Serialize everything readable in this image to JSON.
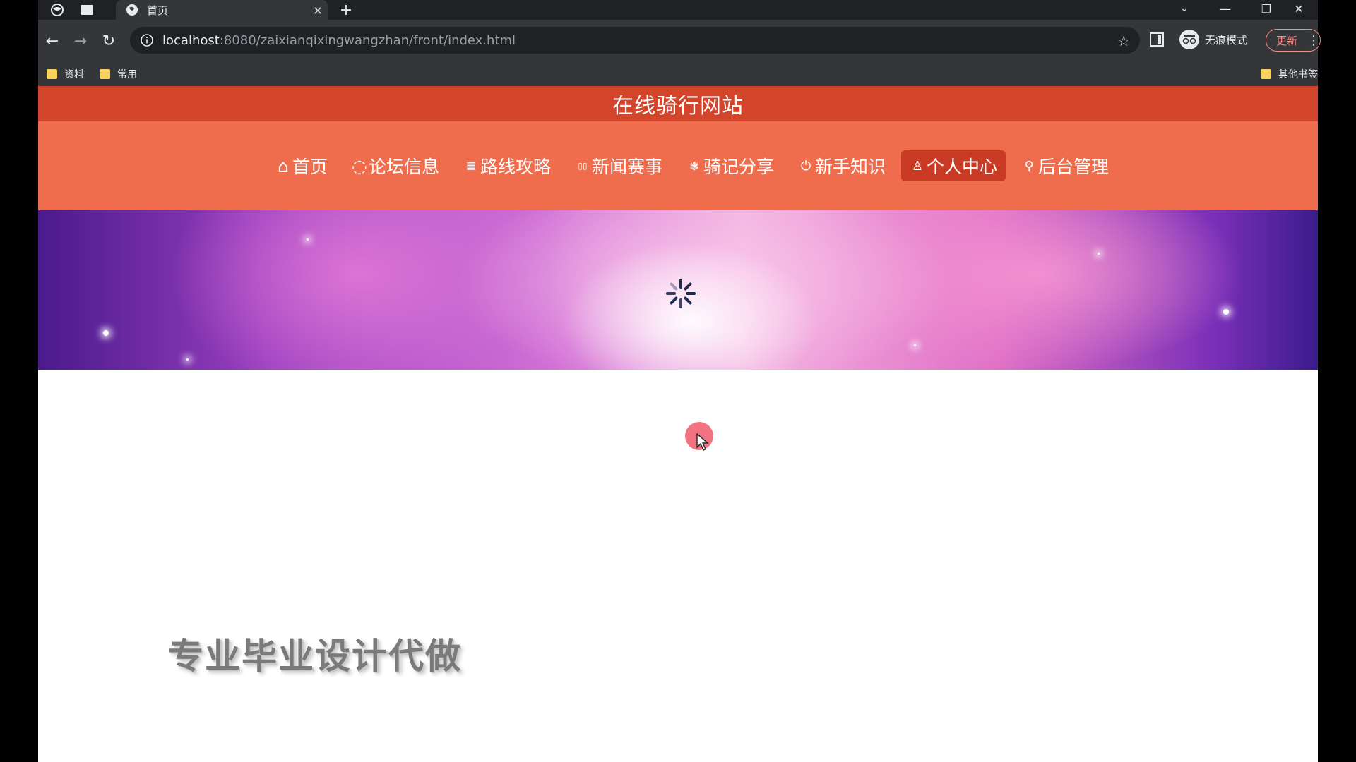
{
  "browser": {
    "tab": {
      "title": "首页",
      "close": "×"
    },
    "new_tab": "+",
    "window_controls": {
      "minimize": "—",
      "restore": "❐",
      "close": "✕"
    },
    "toolbar": {
      "back": "←",
      "forward": "→",
      "reload": "↻",
      "url_host": "localhost",
      "url_path": ":8080/zaixianqixingwangzhan/front/index.html",
      "star": "☆",
      "incognito_label": "无痕模式",
      "update_label": "更新",
      "menu": "⋮"
    },
    "bookmarks": [
      {
        "label": "资料"
      },
      {
        "label": "常用"
      }
    ],
    "other_bookmarks": "其他书签"
  },
  "site": {
    "title": "在线骑行网站",
    "nav": [
      {
        "label": "首页",
        "icon": "home-icon",
        "glyph": "⌂",
        "active": false
      },
      {
        "label": "论坛信息",
        "icon": "forum-icon",
        "glyph": "◌",
        "active": false
      },
      {
        "label": "路线攻略",
        "icon": "route-icon",
        "glyph": "▦",
        "active": false
      },
      {
        "label": "新闻赛事",
        "icon": "news-icon",
        "glyph": "▯▯",
        "active": false
      },
      {
        "label": "骑记分享",
        "icon": "share-icon",
        "glyph": "❃",
        "active": false
      },
      {
        "label": "新手知识",
        "icon": "knowledge-icon",
        "glyph": "⏻",
        "active": false
      },
      {
        "label": "个人中心",
        "icon": "user-icon",
        "glyph": "♙",
        "active": true
      },
      {
        "label": "后台管理",
        "icon": "link-icon",
        "glyph": "⚲",
        "active": false
      }
    ],
    "promo_text": "专业毕业设计代做"
  },
  "colors": {
    "header_bg": "#d3452a",
    "nav_bg": "#ef6c4c",
    "nav_active_bg": "#c83a24"
  }
}
